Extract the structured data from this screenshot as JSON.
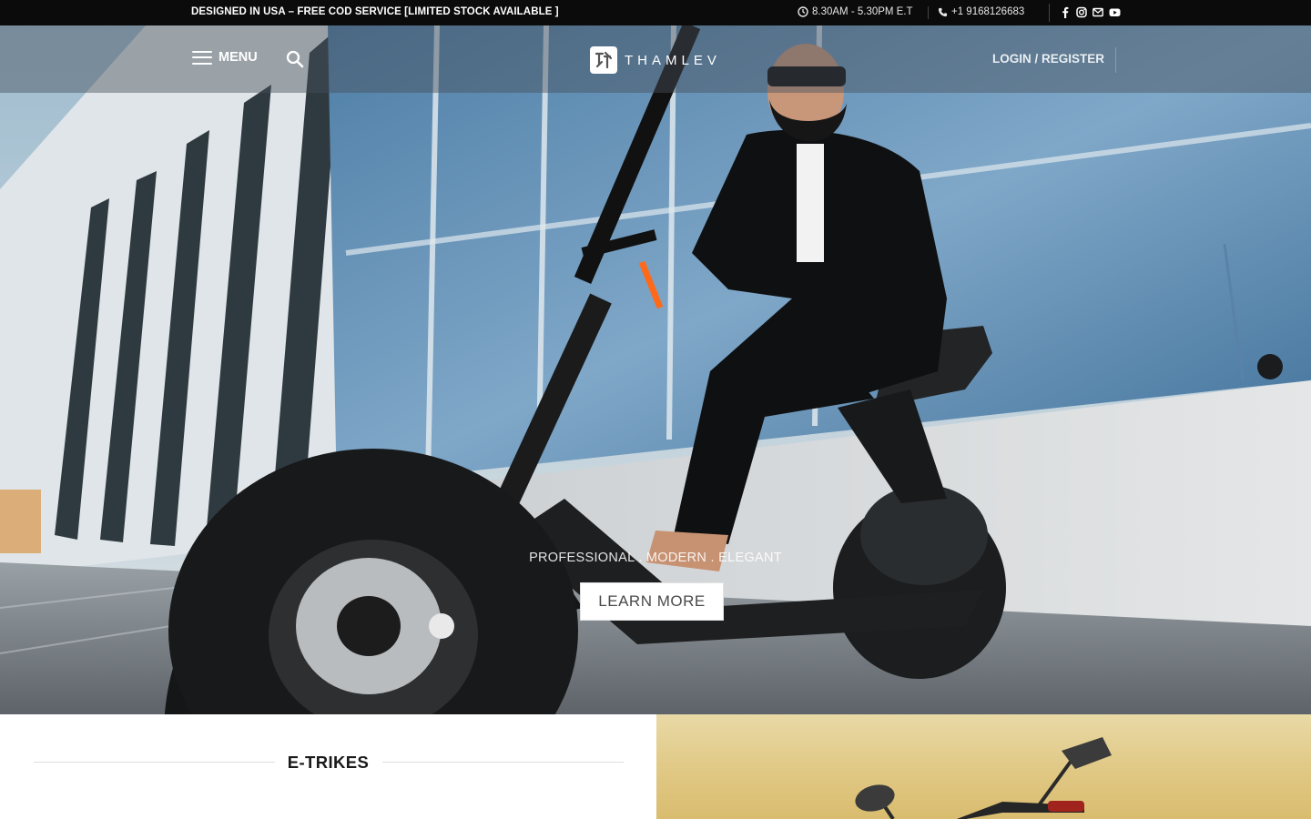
{
  "topbar": {
    "promo": "DESIGNED IN USA – FREE COD SERVICE [LIMITED STOCK AVAILABLE ]",
    "hours": "8.30AM - 5.30PM E.T",
    "phone": "+1 9168126683",
    "social_icons": [
      "facebook-icon",
      "instagram-icon",
      "email-icon",
      "youtube-icon"
    ]
  },
  "header": {
    "menu_label": "MENU",
    "logo_text": "THAMLEV",
    "login_label": "LOGIN / REGISTER"
  },
  "hero": {
    "tagline": "PROFESSIONAL . MODERN . ELEGANT",
    "cta_label": "LEARN MORE"
  },
  "sections": {
    "etrikes_title": "E-TRIKES"
  },
  "colors": {
    "topbar_bg": "#0b0b0b",
    "header_overlay": "rgba(70,80,90,0.45)",
    "button_bg": "#ffffff",
    "title_text": "#1a1a1a"
  }
}
